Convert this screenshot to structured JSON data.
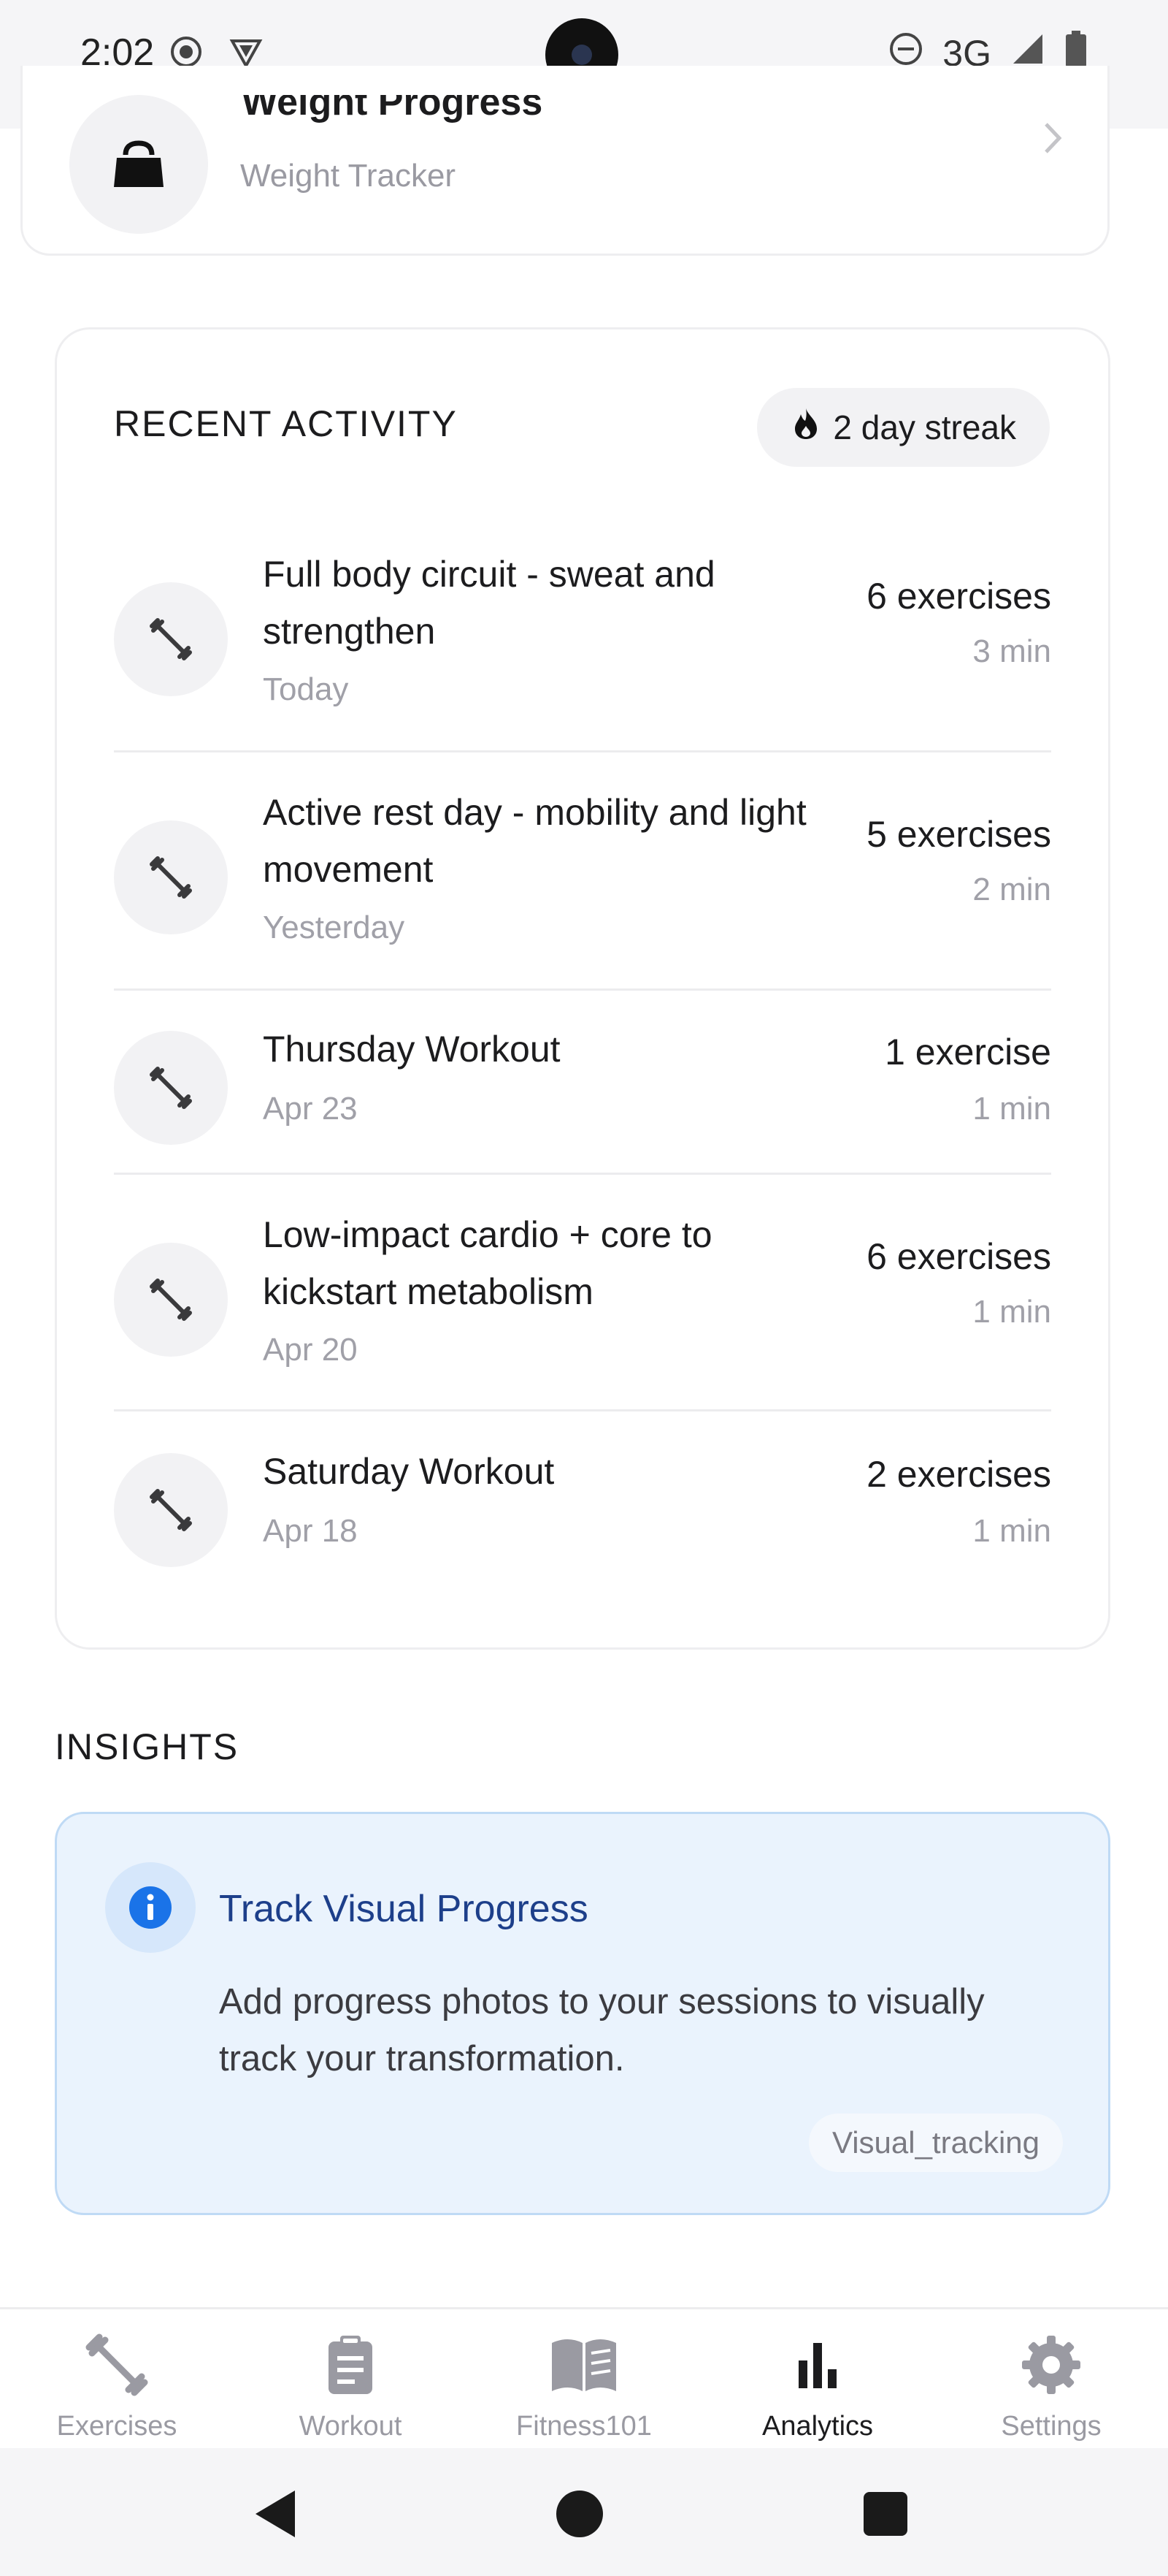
{
  "status_bar": {
    "time": "2:02",
    "network": "3G",
    "icons": [
      "recording-icon",
      "vpn-shield-icon",
      "dnd-icon",
      "signal-icon",
      "battery-icon"
    ]
  },
  "weight_card": {
    "title": "Weight Progress",
    "subtitle": "Weight Tracker",
    "icon": "kettlebell-icon"
  },
  "recent_activity": {
    "header": "RECENT ACTIVITY",
    "streak": "2 day streak",
    "items": [
      {
        "title": "Full body circuit - sweat and strengthen",
        "date": "Today",
        "count": "6 exercises",
        "duration": "3 min"
      },
      {
        "title": "Active rest day - mobility and light movement",
        "date": "Yesterday",
        "count": "5 exercises",
        "duration": "2 min"
      },
      {
        "title": "Thursday Workout",
        "date": "Apr 23",
        "count": "1 exercise",
        "duration": "1 min"
      },
      {
        "title": "Low-impact cardio + core to kickstart metabolism",
        "date": "Apr 20",
        "count": "6 exercises",
        "duration": "1 min"
      },
      {
        "title": "Saturday Workout",
        "date": "Apr 18",
        "count": "2 exercises",
        "duration": "1 min"
      }
    ]
  },
  "insights": {
    "header": "INSIGHTS",
    "card": {
      "title": "Track Visual Progress",
      "body": "Add progress photos to your sessions to visually track your transformation.",
      "tag": "Visual_tracking"
    }
  },
  "bottom_nav": {
    "items": [
      {
        "label": "Exercises",
        "icon": "dumbbell-icon"
      },
      {
        "label": "Workout",
        "icon": "clipboard-icon"
      },
      {
        "label": "Fitness101",
        "icon": "book-icon"
      },
      {
        "label": "Analytics",
        "icon": "bar-chart-icon",
        "active": true
      },
      {
        "label": "Settings",
        "icon": "gear-icon"
      }
    ]
  },
  "colors": {
    "accent_blue": "#1d3f8a",
    "info_blue": "#1a73e8",
    "insight_bg": "#eaf3fd",
    "muted_text": "#a0a0a8"
  }
}
